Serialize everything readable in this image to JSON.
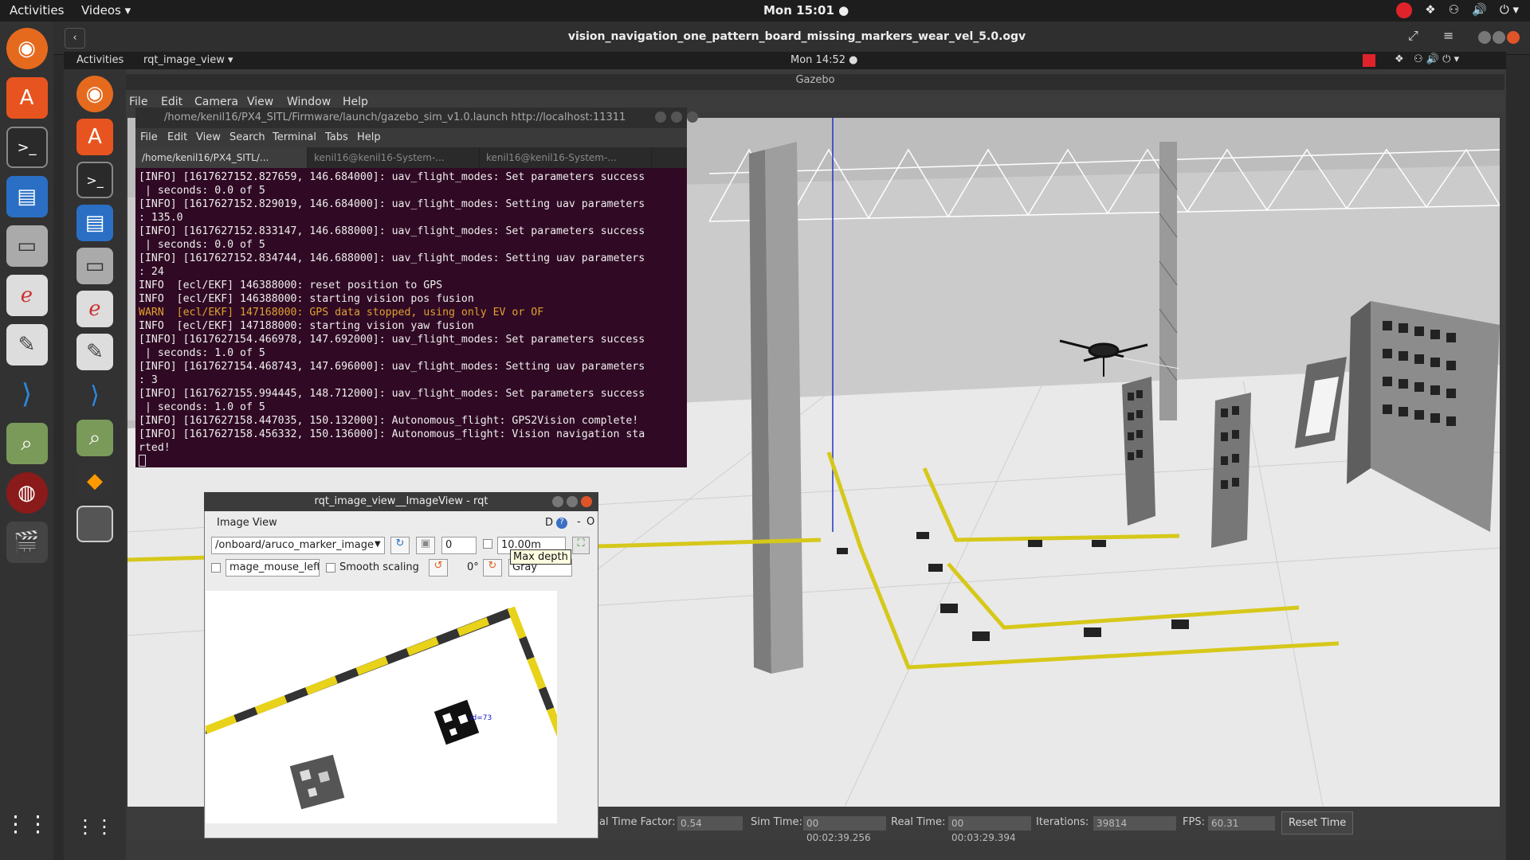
{
  "outer_bar": {
    "activities": "Activities",
    "app_menu": "Videos ▾",
    "clock": "Mon 15:01 ●"
  },
  "video": {
    "title": "vision_navigation_one_pattern_board_missing_markers_wear_vel_5.0.ogv"
  },
  "inner_bar": {
    "activities": "Activities",
    "app_menu": "rqt_image_view ▾",
    "clock": "Mon 14:52 ●"
  },
  "gazebo": {
    "title": "Gazebo",
    "menu": [
      "File",
      "Edit",
      "Camera",
      "View",
      "Window",
      "Help"
    ],
    "status": {
      "rtf_label": "al Time Factor:",
      "rtf_value": "0.54",
      "sim_label": "Sim Time:",
      "sim_value": "00 00:02:39.256",
      "real_label": "Real Time:",
      "real_value": "00 00:03:29.394",
      "iter_label": "Iterations:",
      "iter_value": "39814",
      "fps_label": "FPS:",
      "fps_value": "60.31",
      "reset": "Reset Time"
    }
  },
  "terminal": {
    "title": "/home/kenil16/PX4_SITL/Firmware/launch/gazebo_sim_v1.0.launch http://localhost:11311",
    "menu": [
      "File",
      "Edit",
      "View",
      "Search",
      "Terminal",
      "Tabs",
      "Help"
    ],
    "tabs": [
      "/home/kenil16/PX4_SITL/...",
      "kenil16@kenil16-System-...",
      "kenil16@kenil16-System-..."
    ],
    "lines": [
      "[INFO] [1617627152.827659, 146.684000]: uav_flight_modes: Set parameters success",
      " | seconds: 0.0 of 5",
      "[INFO] [1617627152.829019, 146.684000]: uav_flight_modes: Setting uav parameters",
      ": 135.0",
      "[INFO] [1617627152.833147, 146.688000]: uav_flight_modes: Set parameters success",
      " | seconds: 0.0 of 5",
      "[INFO] [1617627152.834744, 146.688000]: uav_flight_modes: Setting uav parameters",
      ": 24",
      "INFO  [ecl/EKF] 146388000: reset position to GPS",
      "INFO  [ecl/EKF] 146388000: starting vision pos fusion",
      "WARN  [ecl/EKF] 147168000: GPS data stopped, using only EV or OF",
      "INFO  [ecl/EKF] 147188000: starting vision yaw fusion",
      "[INFO] [1617627154.466978, 147.692000]: uav_flight_modes: Set parameters success",
      " | seconds: 1.0 of 5",
      "[INFO] [1617627154.468743, 147.696000]: uav_flight_modes: Setting uav parameters",
      ": 3",
      "[INFO] [1617627155.994445, 148.712000]: uav_flight_modes: Set parameters success",
      " | seconds: 1.0 of 5",
      "[INFO] [1617627158.447035, 150.132000]: Autonomous_flight: GPS2Vision complete!",
      "[INFO] [1617627158.456332, 150.136000]: Autonomous_flight: Vision navigation sta",
      "rted!"
    ],
    "warn_line_index": 10
  },
  "rqt": {
    "title": "rqt_image_view__ImageView - rqt",
    "panel": "Image View",
    "topic": "/onboard/aruco_marker_image",
    "spin_value": "0",
    "depth_value": "10.00m",
    "tooltip": "Max depth",
    "mouse_topic": "mage_mouse_left",
    "smooth": "Smooth scaling",
    "angle": "0°",
    "colormap": "Gray",
    "dock_btns": "D",
    "marker_label": "id=73"
  }
}
